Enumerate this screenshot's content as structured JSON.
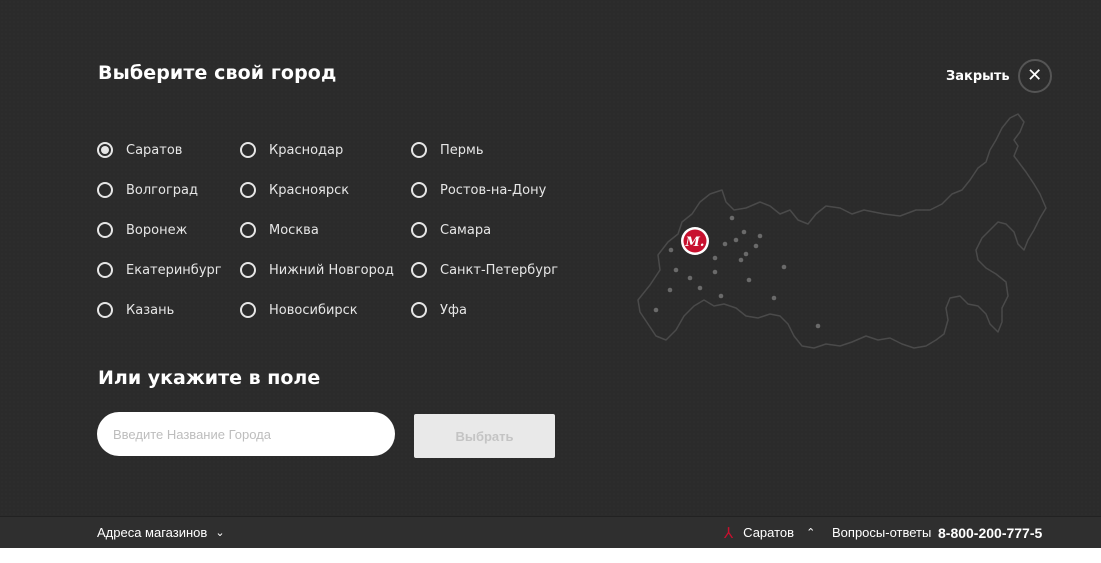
{
  "modal": {
    "title": "Выберите свой город",
    "close_label": "Закрыть",
    "subtitle": "Или укажите в поле",
    "input_placeholder": "Введите Название Города",
    "select_label": "Выбрать",
    "selected_city": "Саратов",
    "cities": [
      [
        "Саратов",
        "Волгоград",
        "Воронеж",
        "Екатеринбург",
        "Казань"
      ],
      [
        "Краснодар",
        "Красноярск",
        "Москва",
        "Нижний Новгород",
        "Новосибирск"
      ],
      [
        "Пермь",
        "Ростов-на-Дону",
        "Самара",
        "Санкт-Петербург",
        "Уфа"
      ]
    ],
    "map_badge": "М."
  },
  "bottom_bar": {
    "stores_label": "Адреса магазинов",
    "current_city": "Саратов",
    "faq_label": "Вопросы-ответы",
    "phone": "8-800-200-777-5"
  },
  "colors": {
    "background": "#2b2b2b",
    "accent_red": "#c8102e",
    "text": "#e6e6e6"
  }
}
